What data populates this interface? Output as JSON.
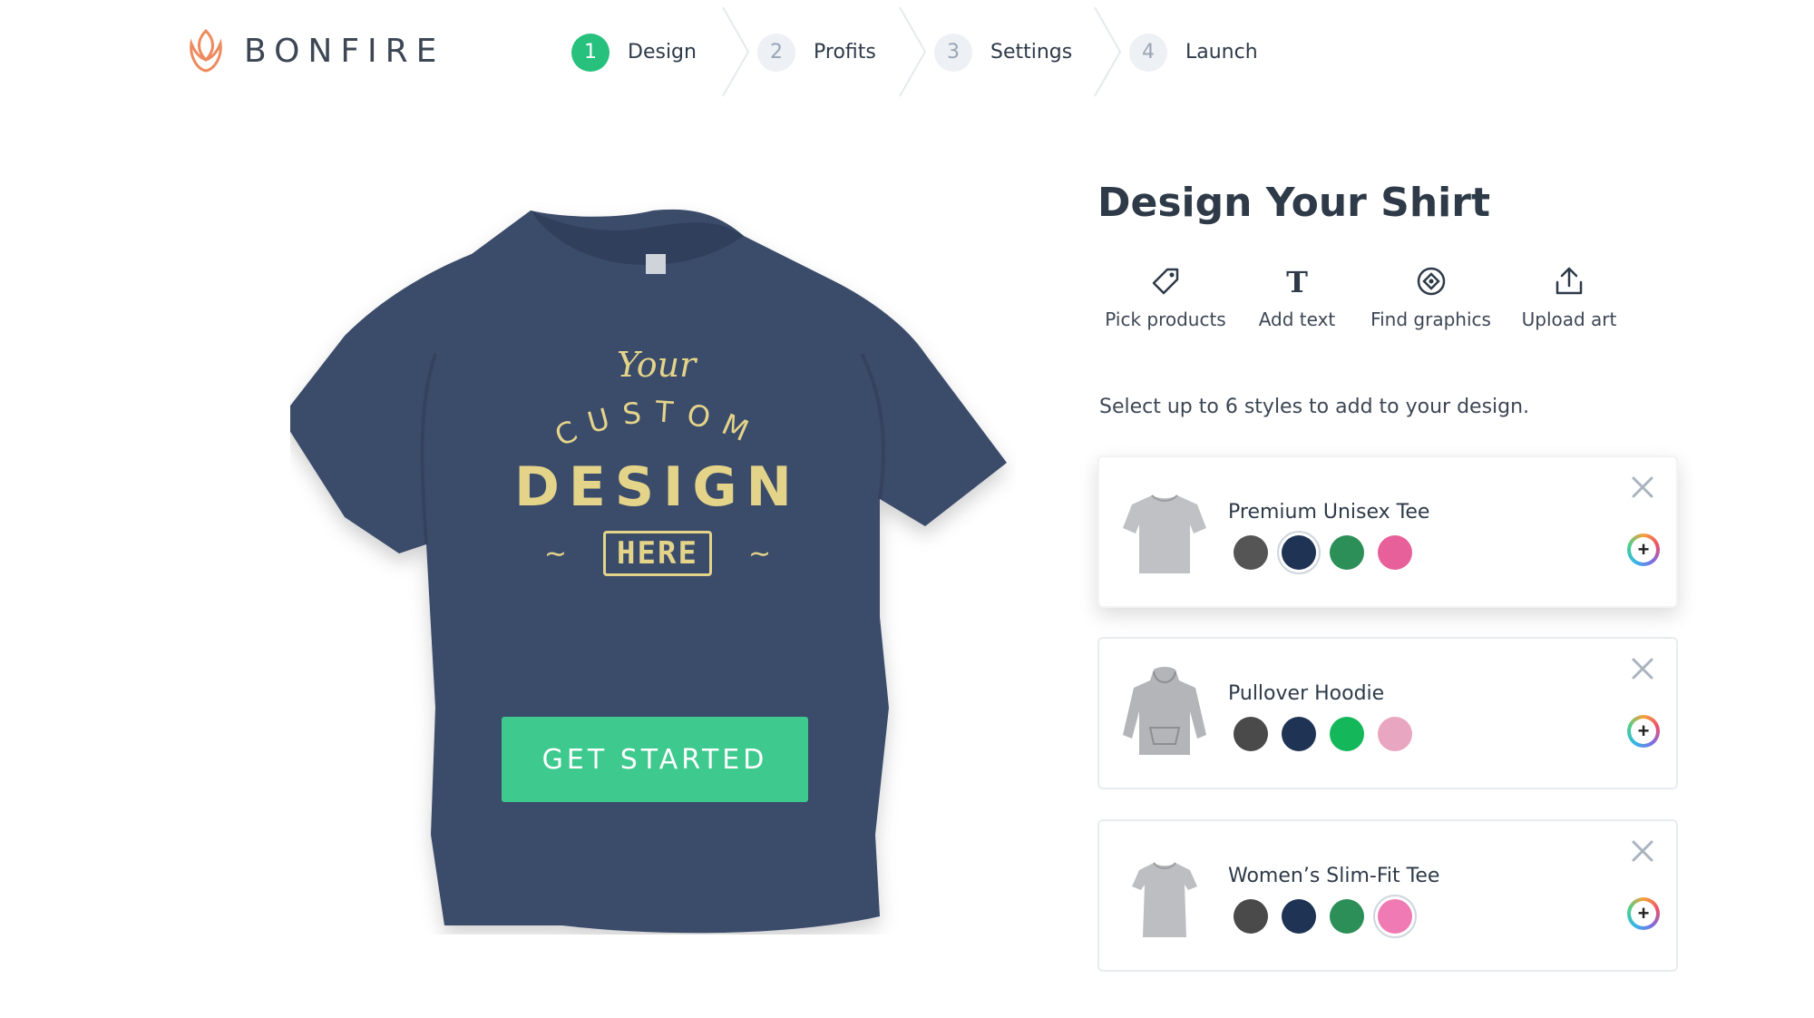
{
  "brand": {
    "name": "BONFIRE",
    "logo_icon": "flame-petal-icon"
  },
  "steps": [
    {
      "num": "1",
      "label": "Design",
      "active": true
    },
    {
      "num": "2",
      "label": "Profits",
      "active": false
    },
    {
      "num": "3",
      "label": "Settings",
      "active": false
    },
    {
      "num": "4",
      "label": "Launch",
      "active": false
    }
  ],
  "preview": {
    "shirt_color": "#3a4b6a",
    "design_text": {
      "line1": "Your",
      "line2": "CUSTOM",
      "line3": "DESIGN",
      "line4": "HERE"
    },
    "cta": "GET STARTED"
  },
  "panel": {
    "title": "Design Your Shirt",
    "tools": [
      {
        "icon": "tag-icon",
        "label": "Pick products"
      },
      {
        "icon": "text-icon",
        "label": "Add text"
      },
      {
        "icon": "compass-icon",
        "label": "Find graphics"
      },
      {
        "icon": "upload-icon",
        "label": "Upload art"
      }
    ],
    "hint": "Select up to 6 styles to add to your design.",
    "products": [
      {
        "name": "Premium Unisex Tee",
        "type": "tee",
        "colors": [
          "#555555",
          "#1f3354",
          "#2b8f57",
          "#e8609a"
        ],
        "selected_color": 1
      },
      {
        "name": "Pullover Hoodie",
        "type": "hoodie",
        "colors": [
          "#4a4a4a",
          "#1f3354",
          "#14b85a",
          "#e9a6c0"
        ],
        "selected_color": -1
      },
      {
        "name": "Women’s Slim-Fit Tee",
        "type": "tee",
        "colors": [
          "#4a4a4a",
          "#1f3354",
          "#2b8f57",
          "#f07ab4"
        ],
        "selected_color": 3
      }
    ]
  },
  "accent": "#3ec98e"
}
